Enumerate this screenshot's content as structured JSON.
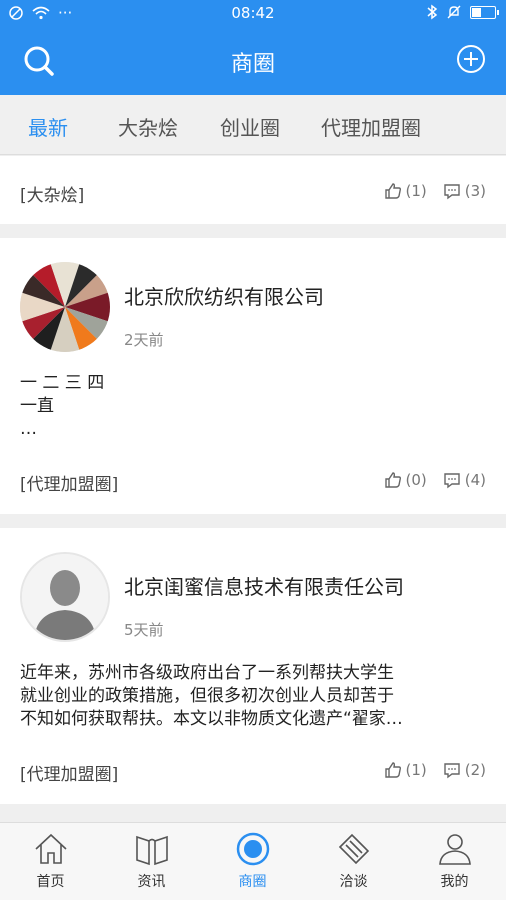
{
  "status_bar": {
    "time": "08:42",
    "dots": "···"
  },
  "header": {
    "title": "商圈"
  },
  "tabs": [
    {
      "label": "最新",
      "active": true
    },
    {
      "label": "大杂烩",
      "active": false
    },
    {
      "label": "创业圈",
      "active": false
    },
    {
      "label": "代理加盟圈",
      "active": false
    }
  ],
  "posts": [
    {
      "category": "[大杂烩]",
      "likes": "(1)",
      "comments": "(3)"
    },
    {
      "company": "北京欣欣纺织有限公司",
      "time": "2天前",
      "text_line1": "一 二  三   四",
      "text_line2": "一直",
      "text_line3": "…",
      "category": "[代理加盟圈]",
      "likes": "(0)",
      "comments": "(4)"
    },
    {
      "company": "北京闺蜜信息技术有限责任公司",
      "time": "5天前",
      "text_line1": "近年来，苏州市各级政府出台了一系列帮扶大学生",
      "text_line2": "就业创业的政策措施，但很多初次创业人员却苦于",
      "text_line3": "不知如何获取帮扶。本文以非物质文化遗产“翟家…",
      "category": "[代理加盟圈]",
      "likes": "(1)",
      "comments": "(2)"
    }
  ],
  "bottom_nav": [
    {
      "label": "首页",
      "icon": "home-icon"
    },
    {
      "label": "资讯",
      "icon": "book-icon"
    },
    {
      "label": "商圈",
      "icon": "circle-icon",
      "active": true
    },
    {
      "label": "洽谈",
      "icon": "handshake-icon"
    },
    {
      "label": "我的",
      "icon": "user-icon"
    }
  ],
  "colors": {
    "accent": "#2b8ff0",
    "background": "#efefef"
  }
}
